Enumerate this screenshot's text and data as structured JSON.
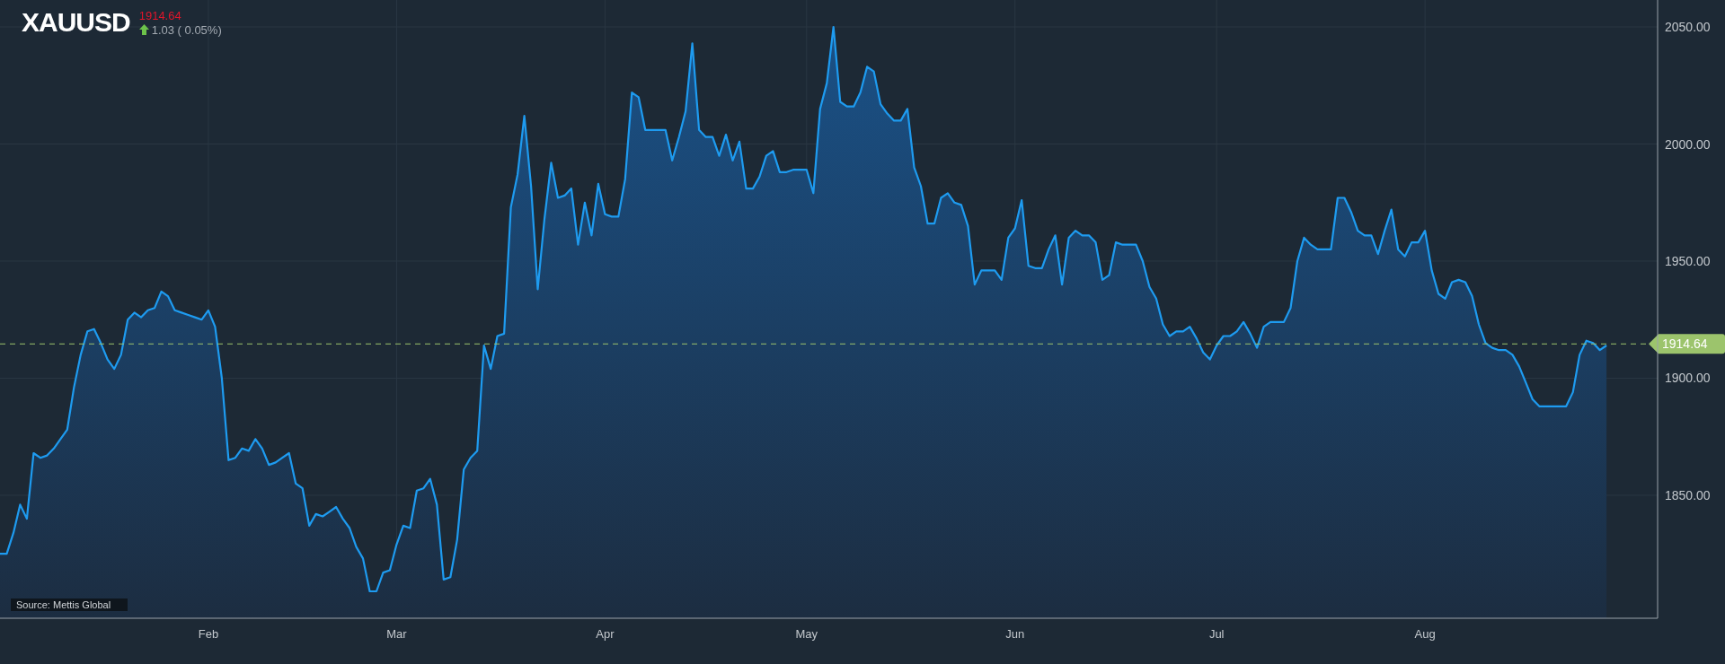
{
  "header": {
    "price": "1914.64",
    "change": "1.03 ( 0.05%)",
    "rising": true
  },
  "chart": {
    "chart_data": {
      "type": "area",
      "categories": [
        null,
        null,
        null,
        null,
        null,
        null,
        null,
        null,
        null,
        null,
        null,
        null,
        null,
        null,
        null,
        null,
        null,
        null,
        null,
        null,
        null,
        null,
        null,
        null,
        null,
        null,
        null,
        null,
        null,
        null,
        null,
        "Feb",
        null,
        null,
        null,
        null,
        null,
        null,
        null,
        null,
        null,
        null,
        null,
        null,
        null,
        null,
        null,
        null,
        null,
        null,
        null,
        null,
        null,
        null,
        null,
        null,
        null,
        null,
        null,
        "Mar",
        null,
        null,
        null,
        null,
        null,
        null,
        null,
        null,
        null,
        null,
        null,
        null,
        null,
        null,
        null,
        null,
        null,
        null,
        null,
        null,
        null,
        null,
        null,
        null,
        null,
        null,
        null,
        null,
        null,
        null,
        "Apr",
        null,
        null,
        null,
        null,
        null,
        null,
        null,
        null,
        null,
        null,
        null,
        null,
        null,
        null,
        null,
        null,
        null,
        null,
        null,
        null,
        null,
        null,
        null,
        null,
        null,
        null,
        null,
        null,
        null,
        "May",
        null,
        null,
        null,
        null,
        null,
        null,
        null,
        null,
        null,
        null,
        null,
        null,
        null,
        null,
        null,
        null,
        null,
        null,
        null,
        null,
        null,
        null,
        null,
        null,
        null,
        null,
        null,
        null,
        null,
        null,
        "Jun",
        null,
        null,
        null,
        null,
        null,
        null,
        null,
        null,
        null,
        null,
        null,
        null,
        null,
        null,
        null,
        null,
        null,
        null,
        null,
        null,
        null,
        null,
        null,
        null,
        null,
        null,
        null,
        null,
        null,
        "Jul",
        null,
        null,
        null,
        null,
        null,
        null,
        null,
        null,
        null,
        null,
        null,
        null,
        null,
        null,
        null,
        null,
        null,
        null,
        null,
        null,
        null,
        null,
        null,
        null,
        null,
        null,
        null,
        null,
        null,
        null,
        "Aug",
        null,
        null,
        null,
        null,
        null,
        null,
        null,
        null,
        null,
        null,
        null,
        null,
        null,
        null,
        null,
        null,
        null,
        null,
        null,
        null,
        null,
        null,
        null,
        null,
        null,
        null,
        null
      ],
      "series": [
        {
          "name": "XAUUSD",
          "color": "#1e9bf0",
          "values": [
            1825,
            1825,
            1834,
            1846,
            1840,
            1868,
            1866,
            1867,
            1870,
            1874,
            1878,
            1896,
            1910,
            1920,
            1921,
            1915,
            1908,
            1904,
            1910,
            1925,
            1928,
            1926,
            1929,
            1930,
            1937,
            1935,
            1929,
            1928,
            1927,
            1926,
            1925,
            1929,
            1922,
            1900,
            1865,
            1866,
            1870,
            1869,
            1874,
            1870,
            1863,
            1864,
            1866,
            1868,
            1855,
            1853,
            1837,
            1842,
            1841,
            1843,
            1845,
            1840,
            1836,
            1828,
            1823,
            1809,
            1809,
            1817,
            1818,
            1829,
            1837,
            1836,
            1852,
            1853,
            1857,
            1846,
            1814,
            1815,
            1831,
            1861,
            1866,
            1869,
            1914,
            1904,
            1918,
            1919,
            1973,
            1987,
            2012,
            1982,
            1938,
            1968,
            1992,
            1977,
            1978,
            1981,
            1957,
            1975,
            1961,
            1983,
            1970,
            1969,
            1969,
            1985,
            2022,
            2020,
            2006,
            2006,
            2006,
            2006,
            1993,
            2003,
            2014,
            2043,
            2006,
            2003,
            2003,
            1995,
            2004,
            1993,
            2001,
            1981,
            1981,
            1986,
            1995,
            1997,
            1988,
            1988,
            1989,
            1989,
            1989,
            1979,
            2015,
            2026,
            2050,
            2018,
            2016,
            2016,
            2022,
            2033,
            2031,
            2017,
            2013,
            2010,
            2010,
            2015,
            1990,
            1982,
            1966,
            1966,
            1977,
            1979,
            1975,
            1974,
            1965,
            1940,
            1946,
            1946,
            1946,
            1942,
            1960,
            1964,
            1976,
            1948,
            1947,
            1947,
            1955,
            1961,
            1940,
            1960,
            1963,
            1961,
            1961,
            1958,
            1942,
            1944,
            1958,
            1957,
            1957,
            1957,
            1950,
            1939,
            1934,
            1923,
            1918,
            1920,
            1920,
            1922,
            1917,
            1911,
            1908,
            1914,
            1918,
            1918,
            1920,
            1924,
            1919,
            1913,
            1922,
            1924,
            1924,
            1924,
            1930,
            1950,
            1960,
            1957,
            1955,
            1955,
            1955,
            1977,
            1977,
            1971,
            1963,
            1961,
            1961,
            1953,
            1963,
            1972,
            1955,
            1952,
            1958,
            1958,
            1963,
            1946,
            1936,
            1934,
            1941,
            1942,
            1941,
            1935,
            1923,
            1915,
            1913,
            1912,
            1912,
            1910,
            1905,
            1898,
            1891,
            1888,
            1888,
            1888,
            1888,
            1888,
            1894,
            1910,
            1916,
            1915,
            1912,
            1914
          ]
        }
      ],
      "grid": true,
      "ylim": [
        1797.5,
        2061.5
      ],
      "yticks": [
        {
          "value": 1850,
          "label": "1850.00"
        },
        {
          "value": 1900,
          "label": "1900.00"
        },
        {
          "value": 1950,
          "label": "1950.00"
        },
        {
          "value": 2000,
          "label": "2000.00"
        },
        {
          "value": 2050,
          "label": "2050.00"
        }
      ],
      "ref_lines": [
        {
          "axis": "y",
          "value": 1914.64,
          "label": "1914.64",
          "color": "#9cc46c"
        }
      ]
    },
    "source": "Source: Mettis Global"
  }
}
